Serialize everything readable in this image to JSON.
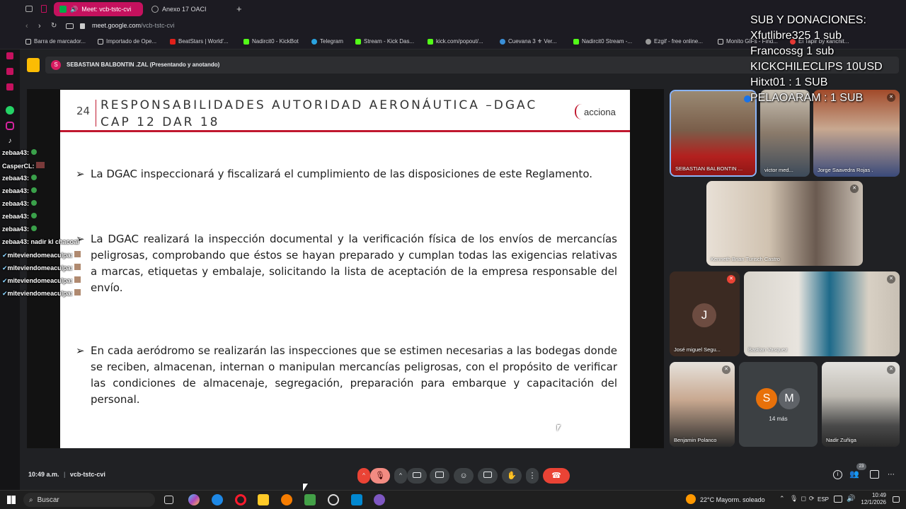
{
  "browser": {
    "tabs": [
      {
        "label": "Meet: vcb-tstc-cvi",
        "active": true
      },
      {
        "label": "Anexo 17 OACI",
        "active": false
      }
    ],
    "url_host": "meet.google.com",
    "url_path": "/vcb-tstc-cvi",
    "bookmarks": [
      "Barra de marcador...",
      "Importado de Ope...",
      "BeatStars | World'...",
      "Nadircit0 - KickBot",
      "Telegram",
      "Stream - Kick Das...",
      "kick.com/popout/...",
      "Cuevana 3 ⚜ Ver...",
      "Nadircit0 Stream -...",
      "Ezgif - free online...",
      "Monito GIFs - Find...",
      "El Tapir by kanchit..."
    ]
  },
  "presenting_banner": "SEBASTIAN BALBONTIN .ZAL (Presentando y anotando)",
  "presenter_initial": "S",
  "slide": {
    "number": "24",
    "title_line1": "RESPONSABILIDADES AUTORIDAD AERONÁUTICA –DGAC",
    "title_line2": "CAP 12 DAR 18",
    "logo": "acciona",
    "bullet_mark": "➢",
    "bullets": [
      "La DGAC inspeccionará y fiscalizará el cumplimiento de las disposiciones de este Reglamento.",
      "La DGAC realizará la inspección documental y la verificación física de los envíos de mercancías peligrosas, comprobando que éstos se hayan preparado y cumplan todas las exigencias relativas a marcas, etiquetas y embalaje, solicitando la lista de aceptación de la empresa responsable del envío.",
      "En cada aeródromo se realizarán las inspecciones que se estimen necesarias a las bodegas donde se reciben, almacenan, internan o manipulan mercancías peligrosas, con el propósito de verificar las condiciones de almacenaje, segregación, preparación para embarque y capacitación del personal."
    ]
  },
  "participants": [
    {
      "name": "SEBASTIAN BALBONTIN ..."
    },
    {
      "name": "victor med..."
    },
    {
      "name": "Jorge Saavedra Rojas ."
    },
    {
      "name": "Kenneth Brian Turisch Castro"
    },
    {
      "name": "José miguel Segu...",
      "initial": "J"
    },
    {
      "name": "Bastian Vasquez"
    },
    {
      "name": "Benjamin Polanco"
    },
    {
      "name": "14 más",
      "initials": [
        "S",
        "M"
      ]
    },
    {
      "name": "Nadir Zuñiga"
    }
  ],
  "stream_overlay": [
    "SUB Y DONACIONES:",
    "Xfutlibre325 1 sub",
    "Francossg 1 sub",
    "KICKCHILECLIPS 10USD",
    "Hitxt01 : 1 SUB",
    "PELAOARAM : 1 SUB"
  ],
  "chat": [
    {
      "user": "zebaa43:",
      "msg": ""
    },
    {
      "user": "CasperCL:",
      "msg": ""
    },
    {
      "user": "zebaa43:",
      "msg": ""
    },
    {
      "user": "zebaa43:",
      "msg": ""
    },
    {
      "user": "zebaa43:",
      "msg": ""
    },
    {
      "user": "zebaa43:",
      "msg": ""
    },
    {
      "user": "zebaa43:",
      "msg": ""
    },
    {
      "user": "zebaa43:",
      "msg": "nadir kl chacoal"
    },
    {
      "user": "miteviendomeaculpa:",
      "msg": ""
    },
    {
      "user": "miteviendomeaculpa:",
      "msg": ""
    },
    {
      "user": "miteviendomeaculpa:",
      "msg": ""
    },
    {
      "user": "miteviendomeaculpa:",
      "msg": ""
    }
  ],
  "meeting_info": {
    "time": "10:49 a.m.",
    "separator": "|",
    "code": "vcb-tstc-cvi"
  },
  "people_badge": "23",
  "taskbar": {
    "search_placeholder": "Buscar",
    "weather": "22°C  Mayorm. soleado",
    "lang": "ESP",
    "time": "10:49",
    "date": "12/1/2026"
  },
  "colors": {
    "slide_rule": "#c0182f",
    "tab_active": "#c5115e",
    "end_call": "#ea4335",
    "muted_red": "#ea4335"
  }
}
